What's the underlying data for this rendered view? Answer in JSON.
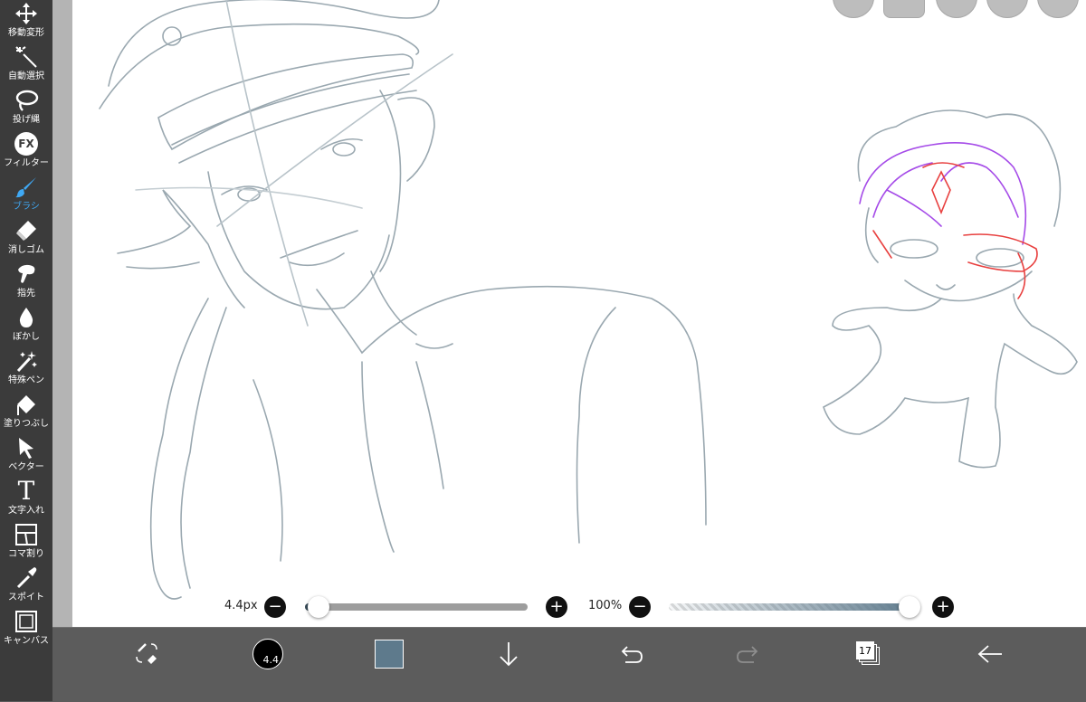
{
  "sidebar": {
    "items": [
      {
        "label": "移動変形",
        "icon": "move-icon"
      },
      {
        "label": "自動選択",
        "icon": "magic-wand-icon"
      },
      {
        "label": "投げ縄",
        "icon": "lasso-icon"
      },
      {
        "label": "フィルター",
        "icon": "fx-filter-icon",
        "icon_text": "FX"
      },
      {
        "label": "ブラシ",
        "icon": "brush-icon",
        "active": true
      },
      {
        "label": "消しゴム",
        "icon": "eraser-icon"
      },
      {
        "label": "指先",
        "icon": "finger-smudge-icon"
      },
      {
        "label": "ぼかし",
        "icon": "blur-drop-icon"
      },
      {
        "label": "特殊ペン",
        "icon": "special-pen-icon"
      },
      {
        "label": "塗りつぶし",
        "icon": "fill-bucket-icon"
      },
      {
        "label": "ベクター",
        "icon": "vector-arrow-icon"
      },
      {
        "label": "文字入れ",
        "icon": "text-icon",
        "icon_text": "T"
      },
      {
        "label": "コマ割り",
        "icon": "frame-divide-icon"
      },
      {
        "label": "スポイト",
        "icon": "eyedropper-icon"
      },
      {
        "label": "キャンバス",
        "icon": "canvas-icon"
      }
    ],
    "active_color": "#3fa9f5"
  },
  "brush_size": {
    "value_label": "4.4px",
    "minus": "−",
    "plus": "+",
    "slider_fraction": 0.02
  },
  "brush_opacity": {
    "value_label": "100%",
    "minus": "−",
    "plus": "+",
    "slider_fraction": 1.0
  },
  "bottom_toolbar": {
    "transform_icon": "transform-eraser-toggle-icon",
    "brush_preview_label": "4.4",
    "current_color": "#5e7a8c",
    "layers_count": "17",
    "icons": [
      "download-arrow-icon",
      "undo-icon",
      "redo-icon",
      "layers-icon",
      "back-arrow-icon"
    ]
  },
  "colors": {
    "sidebar_bg": "#3b3b3b",
    "bottom_bg": "#5c5c5c",
    "sketch_gray": "#9aa8b0",
    "sketch_purple": "#a54be8",
    "sketch_red": "#e8403f"
  }
}
